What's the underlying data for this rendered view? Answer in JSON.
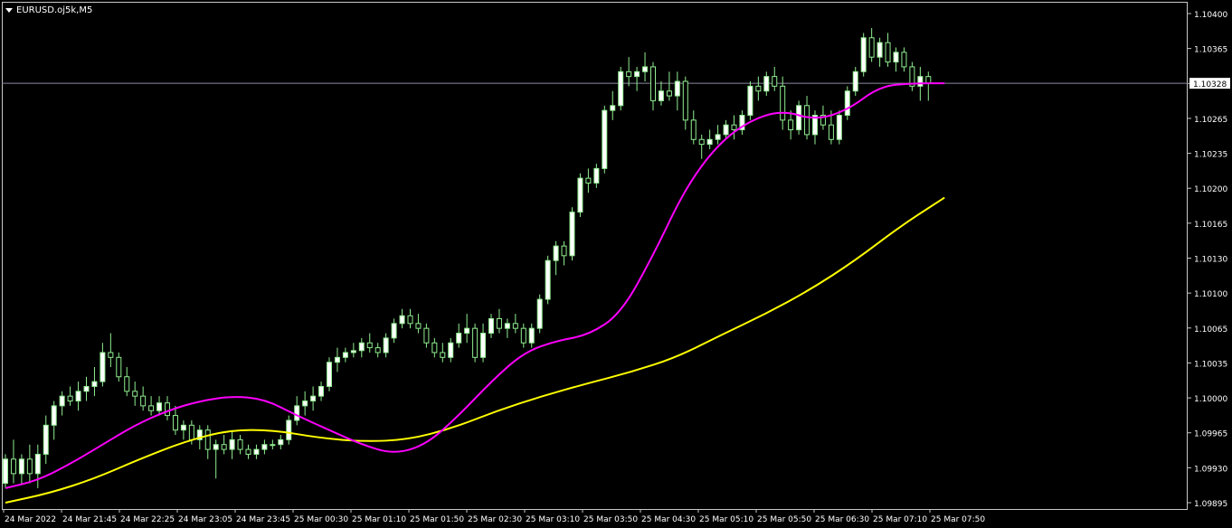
{
  "header": {
    "symbol_label": "EURUSD.oj5k,M5"
  },
  "colors": {
    "background": "#000000",
    "frame": "#c8c8c8",
    "axis_text": "#ffffff",
    "bull_candle": "#90ee90",
    "bull_body": "#ffffff",
    "bear_candle": "#90ee90",
    "bear_body": "#000000",
    "ma_fast": "#ff00ff",
    "ma_slow": "#ffff00",
    "bid_line": "#8a8aa0"
  },
  "chart_data": {
    "type": "candlestick",
    "y_ticks": [
      "1.10400",
      "1.10365",
      "1.10300",
      "1.10265",
      "1.10235",
      "1.10200",
      "1.10165",
      "1.10130",
      "1.10100",
      "1.10065",
      "1.10035",
      "1.10000",
      "1.09965",
      "1.09930",
      "1.09895"
    ],
    "ylim": [
      1.09895,
      1.104
    ],
    "x_labels": [
      "24 Mar 2022",
      "24 Mar 21:45",
      "24 Mar 22:25",
      "24 Mar 23:05",
      "24 Mar 23:45",
      "25 Mar 00:30",
      "25 Mar 01:10",
      "25 Mar 01:50",
      "25 Mar 02:30",
      "25 Mar 03:10",
      "25 Mar 03:50",
      "25 Mar 04:30",
      "25 Mar 05:10",
      "25 Mar 05:50",
      "25 Mar 06:30",
      "25 Mar 07:10",
      "25 Mar 07:50"
    ],
    "current_price": "1.10328",
    "candles": [
      [
        1.09915,
        1.09945,
        1.0991,
        1.0994
      ],
      [
        1.0994,
        1.0996,
        1.09915,
        1.09925
      ],
      [
        1.09925,
        1.09945,
        1.09915,
        1.0994
      ],
      [
        1.0994,
        1.09955,
        1.09915,
        1.09925
      ],
      [
        1.09925,
        1.09955,
        1.0991,
        1.09945
      ],
      [
        1.09945,
        1.09985,
        1.09935,
        1.09975
      ],
      [
        1.09975,
        1.1,
        1.0996,
        1.09995
      ],
      [
        1.09995,
        1.1001,
        1.09985,
        1.10005
      ],
      [
        1.10005,
        1.10015,
        1.09995,
        1.1
      ],
      [
        1.1,
        1.1002,
        1.0999,
        1.1001
      ],
      [
        1.1001,
        1.10025,
        1.1,
        1.10015
      ],
      [
        1.10015,
        1.10035,
        1.10005,
        1.1002
      ],
      [
        1.1002,
        1.1006,
        1.10015,
        1.1005
      ],
      [
        1.1005,
        1.1007,
        1.10035,
        1.10045
      ],
      [
        1.10045,
        1.1005,
        1.1002,
        1.10025
      ],
      [
        1.10025,
        1.10035,
        1.10005,
        1.1001
      ],
      [
        1.1001,
        1.1002,
        1.09995,
        1.10005
      ],
      [
        1.10005,
        1.10015,
        1.0999,
        1.09995
      ],
      [
        1.09995,
        1.10005,
        1.09985,
        1.0999
      ],
      [
        1.0999,
        1.10005,
        1.09985,
        1.09998
      ],
      [
        1.09998,
        1.10005,
        1.0998,
        1.09985
      ],
      [
        1.09985,
        1.09995,
        1.09965,
        1.0997
      ],
      [
        1.0997,
        1.0998,
        1.0996,
        1.09975
      ],
      [
        1.09975,
        1.0998,
        1.09955,
        1.0996
      ],
      [
        1.0996,
        1.09975,
        1.0995,
        1.0997
      ],
      [
        1.0997,
        1.09975,
        1.0994,
        1.0995
      ],
      [
        1.0995,
        1.0996,
        1.0992,
        1.09955
      ],
      [
        1.09955,
        1.09965,
        1.09945,
        1.0995
      ],
      [
        1.0995,
        1.0997,
        1.0994,
        1.0996
      ],
      [
        1.0996,
        1.09965,
        1.09945,
        1.0995
      ],
      [
        1.0995,
        1.09955,
        1.0994,
        1.09945
      ],
      [
        1.09945,
        1.09955,
        1.0994,
        1.0995
      ],
      [
        1.0995,
        1.0996,
        1.09945,
        1.09955
      ],
      [
        1.09955,
        1.0996,
        1.0995,
        1.09955
      ],
      [
        1.09955,
        1.09965,
        1.0995,
        1.0996
      ],
      [
        1.0996,
        1.09985,
        1.09955,
        1.0998
      ],
      [
        1.0998,
        1.10005,
        1.09975,
        1.09995
      ],
      [
        1.09995,
        1.1001,
        1.09985,
        1.1
      ],
      [
        1.1,
        1.10015,
        1.0999,
        1.10005
      ],
      [
        1.10005,
        1.1002,
        1.1,
        1.10015
      ],
      [
        1.10015,
        1.10045,
        1.1001,
        1.1004
      ],
      [
        1.1004,
        1.10055,
        1.1003,
        1.10045
      ],
      [
        1.10045,
        1.10055,
        1.1004,
        1.1005
      ],
      [
        1.1005,
        1.1006,
        1.10045,
        1.10052
      ],
      [
        1.10052,
        1.10065,
        1.10045,
        1.1006
      ],
      [
        1.1006,
        1.1007,
        1.1005,
        1.10055
      ],
      [
        1.10055,
        1.1006,
        1.10045,
        1.1005
      ],
      [
        1.1005,
        1.1007,
        1.10045,
        1.10065
      ],
      [
        1.10065,
        1.10085,
        1.1006,
        1.1008
      ],
      [
        1.1008,
        1.10095,
        1.10075,
        1.10088
      ],
      [
        1.10088,
        1.10095,
        1.10075,
        1.1008
      ],
      [
        1.1008,
        1.1009,
        1.1007,
        1.10075
      ],
      [
        1.10075,
        1.1008,
        1.10055,
        1.1006
      ],
      [
        1.1006,
        1.10065,
        1.10045,
        1.1005
      ],
      [
        1.1005,
        1.1006,
        1.1004,
        1.10045
      ],
      [
        1.10045,
        1.10065,
        1.1004,
        1.1006
      ],
      [
        1.1006,
        1.1008,
        1.10055,
        1.1007
      ],
      [
        1.1007,
        1.1009,
        1.1006,
        1.10075
      ],
      [
        1.10075,
        1.1008,
        1.1004,
        1.10045
      ],
      [
        1.10045,
        1.1008,
        1.1004,
        1.1007
      ],
      [
        1.1007,
        1.1009,
        1.10065,
        1.10085
      ],
      [
        1.10085,
        1.10095,
        1.1007,
        1.10075
      ],
      [
        1.10075,
        1.10085,
        1.10065,
        1.1008
      ],
      [
        1.1008,
        1.1009,
        1.1007,
        1.10075
      ],
      [
        1.10075,
        1.1008,
        1.10055,
        1.1006
      ],
      [
        1.1006,
        1.1008,
        1.10055,
        1.10075
      ],
      [
        1.10075,
        1.1011,
        1.1007,
        1.10105
      ],
      [
        1.10105,
        1.1015,
        1.101,
        1.10145
      ],
      [
        1.10145,
        1.10165,
        1.1013,
        1.1016
      ],
      [
        1.1016,
        1.10165,
        1.1014,
        1.1015
      ],
      [
        1.1015,
        1.102,
        1.10145,
        1.10195
      ],
      [
        1.10195,
        1.10235,
        1.1019,
        1.1023
      ],
      [
        1.1023,
        1.1024,
        1.10215,
        1.10225
      ],
      [
        1.10225,
        1.10245,
        1.1022,
        1.1024
      ],
      [
        1.1024,
        1.10305,
        1.10235,
        1.103
      ],
      [
        1.103,
        1.1032,
        1.1029,
        1.10305
      ],
      [
        1.10305,
        1.10345,
        1.103,
        1.1034
      ],
      [
        1.1034,
        1.10355,
        1.10325,
        1.10335
      ],
      [
        1.10335,
        1.10345,
        1.1032,
        1.1034
      ],
      [
        1.1034,
        1.1036,
        1.1033,
        1.10345
      ],
      [
        1.10345,
        1.1035,
        1.103,
        1.1031
      ],
      [
        1.1031,
        1.1033,
        1.10305,
        1.1032
      ],
      [
        1.1032,
        1.1034,
        1.1031,
        1.10315
      ],
      [
        1.10315,
        1.1034,
        1.103,
        1.1033
      ],
      [
        1.1033,
        1.10335,
        1.1028,
        1.1029
      ],
      [
        1.1029,
        1.103,
        1.10265,
        1.1027
      ],
      [
        1.1027,
        1.10275,
        1.1025,
        1.10265
      ],
      [
        1.10265,
        1.1028,
        1.1026,
        1.1027
      ],
      [
        1.1027,
        1.10285,
        1.10265,
        1.10275
      ],
      [
        1.10275,
        1.1029,
        1.1027,
        1.10285
      ],
      [
        1.10285,
        1.10295,
        1.1027,
        1.1028
      ],
      [
        1.1028,
        1.103,
        1.10275,
        1.10295
      ],
      [
        1.10295,
        1.1033,
        1.1029,
        1.10325
      ],
      [
        1.10325,
        1.10335,
        1.1031,
        1.1032
      ],
      [
        1.1032,
        1.1034,
        1.10315,
        1.10335
      ],
      [
        1.10335,
        1.10345,
        1.1032,
        1.10325
      ],
      [
        1.10325,
        1.10335,
        1.1028,
        1.1029
      ],
      [
        1.1029,
        1.103,
        1.1027,
        1.1028
      ],
      [
        1.1028,
        1.1031,
        1.10275,
        1.10305
      ],
      [
        1.10305,
        1.10315,
        1.1027,
        1.10275
      ],
      [
        1.10275,
        1.103,
        1.10265,
        1.10295
      ],
      [
        1.10295,
        1.10305,
        1.1028,
        1.10285
      ],
      [
        1.10285,
        1.103,
        1.10265,
        1.1027
      ],
      [
        1.1027,
        1.103,
        1.10265,
        1.10295
      ],
      [
        1.10295,
        1.10325,
        1.1029,
        1.1032
      ],
      [
        1.1032,
        1.10345,
        1.10315,
        1.1034
      ],
      [
        1.1034,
        1.1038,
        1.10335,
        1.10375
      ],
      [
        1.10375,
        1.10385,
        1.1035,
        1.10355
      ],
      [
        1.10355,
        1.10375,
        1.10345,
        1.1037
      ],
      [
        1.1037,
        1.1038,
        1.10345,
        1.1035
      ],
      [
        1.1035,
        1.10365,
        1.1034,
        1.1036
      ],
      [
        1.1036,
        1.10365,
        1.1034,
        1.10345
      ],
      [
        1.10345,
        1.1035,
        1.1032,
        1.10325
      ],
      [
        1.10325,
        1.10345,
        1.1031,
        1.10335
      ],
      [
        1.10335,
        1.1034,
        1.1031,
        1.10328
      ]
    ],
    "ma_fast": [
      1.0991,
      1.09918,
      1.09935,
      1.09955,
      1.09975,
      1.0999,
      1.1,
      1.10005,
      1.10002,
      1.09985,
      1.0997,
      1.09955,
      1.09945,
      1.09955,
      1.09985,
      1.1002,
      1.1005,
      1.10062,
      1.10068,
      1.1009,
      1.1015,
      1.1022,
      1.10265,
      1.1029,
      1.103,
      1.1029,
      1.103,
      1.10325,
      1.10328,
      1.10328
    ],
    "ma_slow": [
      1.09895,
      1.09905,
      1.0992,
      1.0994,
      1.09958,
      1.0997,
      1.0997,
      1.09962,
      1.09958,
      1.0996,
      1.09972,
      1.0999,
      1.10005,
      1.10018,
      1.1003,
      1.10045,
      1.10068,
      1.1009,
      1.10115,
      1.10145,
      1.1018,
      1.1021
    ],
    "ma_fast_end_index": 116,
    "ma_slow_end_index": 116
  }
}
